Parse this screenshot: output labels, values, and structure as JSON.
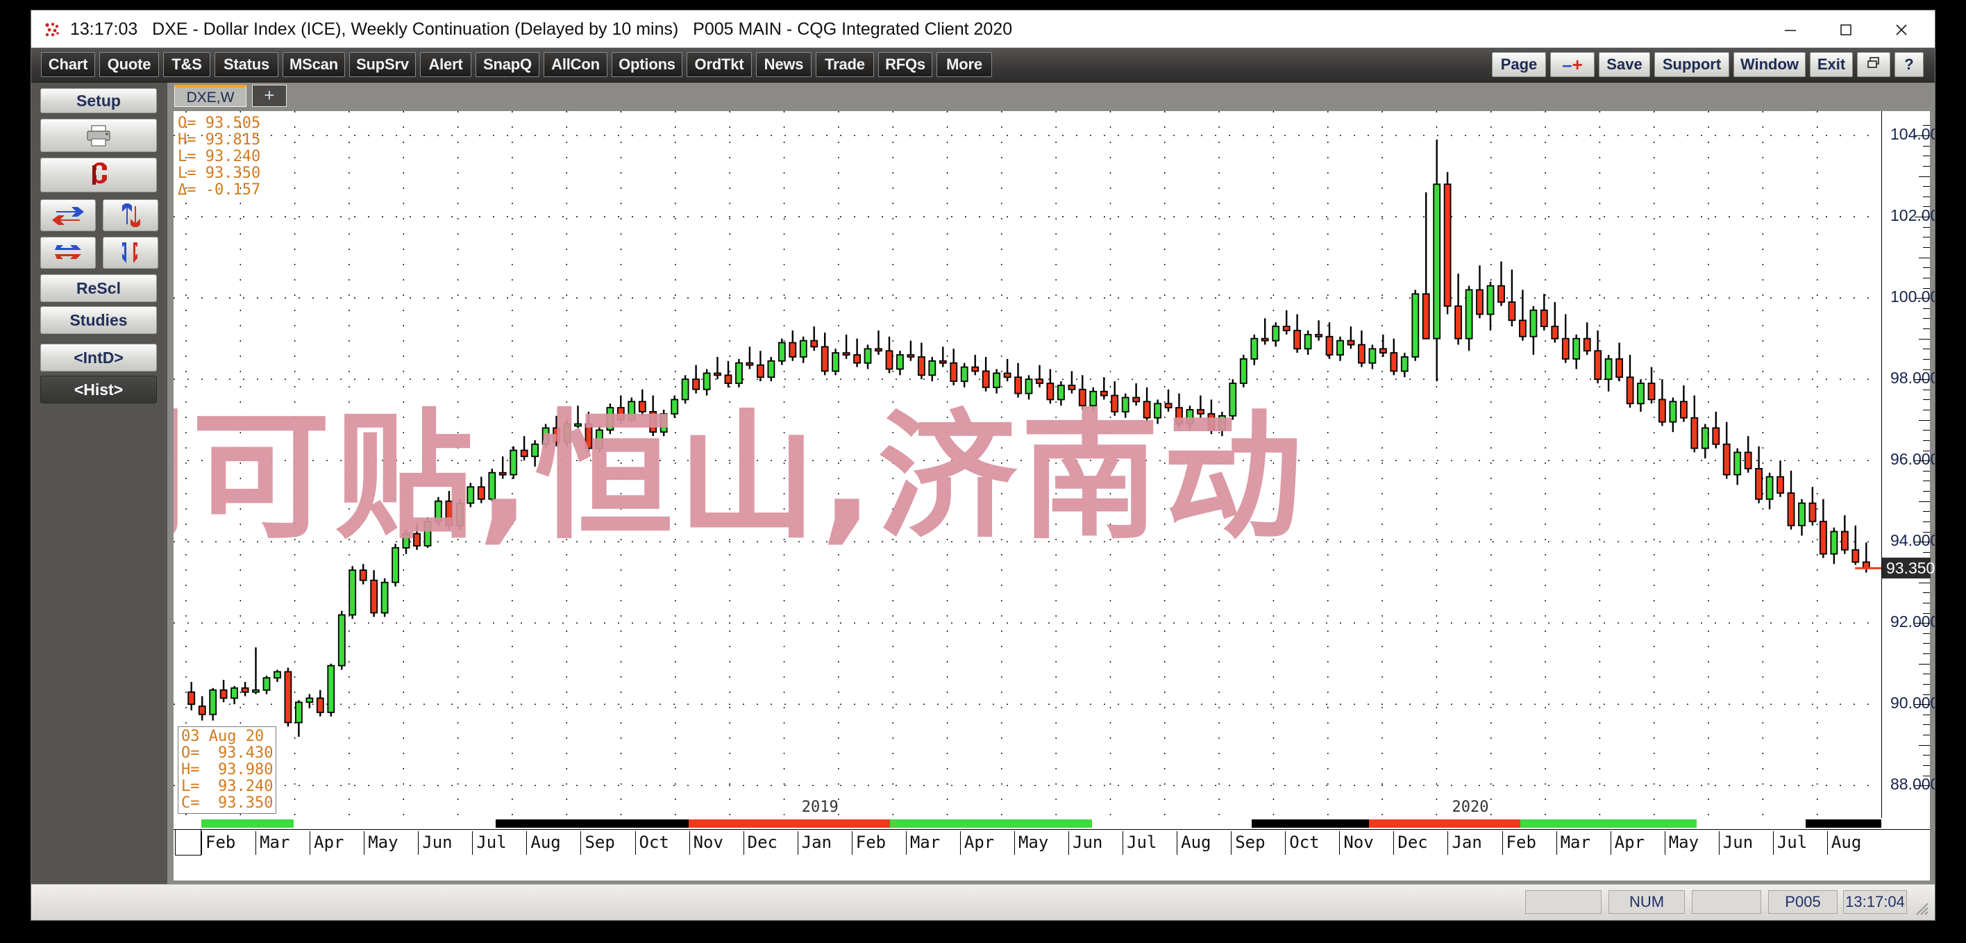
{
  "window": {
    "time": "13:17:03",
    "title": "DXE - Dollar Index (ICE), Weekly Continuation (Delayed by 10 mins)   P005 MAIN - CQG Integrated Client 2020",
    "minimize_label": "–",
    "maximize_label": "□",
    "close_label": "✕"
  },
  "toolbar": {
    "left_buttons": [
      {
        "label": "Chart",
        "w": 78
      },
      {
        "label": "Quote",
        "w": 86
      },
      {
        "label": "T&S",
        "w": 68
      },
      {
        "label": "Status",
        "w": 92
      },
      {
        "label": "MScan",
        "w": 90
      },
      {
        "label": "SupSrv",
        "w": 96
      },
      {
        "label": "Alert",
        "w": 74
      },
      {
        "label": "SnapQ",
        "w": 92
      },
      {
        "label": "AllCon",
        "w": 92
      },
      {
        "label": "Options",
        "w": 102
      },
      {
        "label": "OrdTkt",
        "w": 94
      },
      {
        "label": "News",
        "w": 80
      },
      {
        "label": "Trade",
        "w": 84
      },
      {
        "label": "RFQs",
        "w": 78
      },
      {
        "label": "More",
        "w": 80
      }
    ],
    "right_buttons": [
      {
        "label": "Page",
        "w": 78,
        "name": "page-button"
      },
      {
        "label": "-+",
        "w": 64,
        "name": "minus-plus-button"
      },
      {
        "label": "Save",
        "w": 74,
        "name": "save-button"
      },
      {
        "label": "Support",
        "w": 108,
        "name": "support-button"
      },
      {
        "label": "Window",
        "w": 104,
        "name": "window-button"
      },
      {
        "label": "Exit",
        "w": 62,
        "name": "exit-button"
      },
      {
        "label": "",
        "w": 48,
        "name": "restore-window-icon"
      },
      {
        "label": "?",
        "w": 42,
        "name": "help-button"
      }
    ]
  },
  "sidebar": {
    "items": [
      {
        "label": "Setup",
        "name": "setup-button"
      },
      {
        "label": "",
        "name": "print-icon-button"
      },
      {
        "label": "",
        "name": "magnet-icon-button"
      },
      {
        "label": "",
        "name": "swap-horizontal-icon-button"
      },
      {
        "label": "",
        "name": "swap-vertical-icon-button"
      },
      {
        "label": "",
        "name": "align-horizontal-icon-button"
      },
      {
        "label": "",
        "name": "align-vertical-icon-button"
      },
      {
        "label": "ReScl",
        "name": "rescale-button"
      },
      {
        "label": "Studies",
        "name": "studies-button"
      },
      {
        "label": "<IntD>",
        "name": "intraday-button"
      },
      {
        "label": "<Hist>",
        "name": "historical-button"
      }
    ]
  },
  "tabs": {
    "active": "DXE,W",
    "add": "+"
  },
  "readout_top": {
    "open_label": "O=",
    "open": "93.505",
    "high_label": "H=",
    "high": "93.815",
    "low_label": "L=",
    "low": "93.240",
    "last_label": "L=",
    "last": "93.350",
    "delta_label": "Δ=",
    "delta": "-0.157"
  },
  "readout_bottom": {
    "date": "03 Aug 20",
    "open_label": "O=",
    "open": "93.430",
    "high_label": "H=",
    "high": "93.980",
    "low_label": "L=",
    "low": "93.240",
    "close_label": "C=",
    "close": "93.350"
  },
  "watermark": {
    "text": "创可贴,恒山,济南动"
  },
  "statusbar": {
    "num": "NUM",
    "page": "P005",
    "time": "13:17:04"
  },
  "colors": {
    "up": "#3cdc3c",
    "down": "#ee3a1c",
    "wick": "#000000",
    "cursor_badge_bg": "#2b2b2b",
    "watermark": "#d8929e",
    "accent_tab": "#f7a520"
  },
  "chart_data": {
    "type": "candlestick",
    "title": "DXE - Dollar Index (ICE), Weekly Continuation",
    "xlabel": "",
    "ylabel": "",
    "ylim": [
      87.2,
      104.6
    ],
    "y_ticks": [
      104.0,
      102.0,
      100.0,
      98.0,
      96.0,
      94.0,
      92.0,
      90.0,
      88.0
    ],
    "cursor_price": "93.350",
    "grid": "dotted",
    "x_tick_labels": [
      "Feb",
      "Mar",
      "Apr",
      "May",
      "Jun",
      "Jul",
      "Aug",
      "Sep",
      "Oct",
      "Nov",
      "Dec",
      "Jan",
      "Feb",
      "Mar",
      "Apr",
      "May",
      "Jun",
      "Jul",
      "Aug",
      "Sep",
      "Oct",
      "Nov",
      "Dec",
      "Jan",
      "Feb",
      "Mar",
      "Apr",
      "May",
      "Jun",
      "Jul",
      "Aug"
    ],
    "year_labels": [
      {
        "text": "2019",
        "at_index": 11
      },
      {
        "text": "2020",
        "at_index": 23
      }
    ],
    "year_bar_segments": [
      {
        "start": 0.0,
        "end": 0.055,
        "color": "#3cdc3c"
      },
      {
        "start": 0.055,
        "end": 0.175,
        "color": "#ffffff"
      },
      {
        "start": 0.175,
        "end": 0.29,
        "color": "#000000"
      },
      {
        "start": 0.29,
        "end": 0.41,
        "color": "#ee3a1c"
      },
      {
        "start": 0.41,
        "end": 0.53,
        "color": "#3cdc3c"
      },
      {
        "start": 0.53,
        "end": 0.625,
        "color": "#ffffff"
      },
      {
        "start": 0.625,
        "end": 0.695,
        "color": "#000000"
      },
      {
        "start": 0.695,
        "end": 0.785,
        "color": "#ee3a1c"
      },
      {
        "start": 0.785,
        "end": 0.89,
        "color": "#3cdc3c"
      },
      {
        "start": 0.89,
        "end": 0.955,
        "color": "#ffffff"
      },
      {
        "start": 0.955,
        "end": 1.0,
        "color": "#000000"
      }
    ],
    "ohlc": [
      [
        90.3,
        90.55,
        89.85,
        90.0
      ],
      [
        89.95,
        90.2,
        89.6,
        89.75
      ],
      [
        89.75,
        90.4,
        89.6,
        90.35
      ],
      [
        90.35,
        90.6,
        90.05,
        90.15
      ],
      [
        90.15,
        90.45,
        90.0,
        90.4
      ],
      [
        90.4,
        90.55,
        90.2,
        90.3
      ],
      [
        90.3,
        91.4,
        90.25,
        90.35
      ],
      [
        90.35,
        90.7,
        90.25,
        90.65
      ],
      [
        90.65,
        90.85,
        90.55,
        90.8
      ],
      [
        90.8,
        90.9,
        89.45,
        89.55
      ],
      [
        89.55,
        90.1,
        89.2,
        90.05
      ],
      [
        90.05,
        90.25,
        89.9,
        90.15
      ],
      [
        90.15,
        90.35,
        89.7,
        89.8
      ],
      [
        89.8,
        91.0,
        89.7,
        90.95
      ],
      [
        90.95,
        92.3,
        90.85,
        92.2
      ],
      [
        92.2,
        93.4,
        92.1,
        93.3
      ],
      [
        93.3,
        93.45,
        92.95,
        93.05
      ],
      [
        93.05,
        93.3,
        92.15,
        92.25
      ],
      [
        92.25,
        93.1,
        92.15,
        93.0
      ],
      [
        93.0,
        93.95,
        92.9,
        93.85
      ],
      [
        93.85,
        94.3,
        93.7,
        94.2
      ],
      [
        94.2,
        94.45,
        93.8,
        93.9
      ],
      [
        93.9,
        94.6,
        93.85,
        94.5
      ],
      [
        94.5,
        95.1,
        94.4,
        95.0
      ],
      [
        95.0,
        95.25,
        94.3,
        94.4
      ],
      [
        94.4,
        95.05,
        94.3,
        94.95
      ],
      [
        94.95,
        95.45,
        94.85,
        95.35
      ],
      [
        95.35,
        95.6,
        94.95,
        95.05
      ],
      [
        95.05,
        95.8,
        95.0,
        95.7
      ],
      [
        95.7,
        96.1,
        95.55,
        95.65
      ],
      [
        95.65,
        96.35,
        95.55,
        96.25
      ],
      [
        96.25,
        96.6,
        96.0,
        96.1
      ],
      [
        96.1,
        96.5,
        95.85,
        96.4
      ],
      [
        96.4,
        96.9,
        96.3,
        96.8
      ],
      [
        96.8,
        97.1,
        96.35,
        96.45
      ],
      [
        96.45,
        97.0,
        96.35,
        96.9
      ],
      [
        96.9,
        97.35,
        96.8,
        96.9
      ],
      [
        96.9,
        97.2,
        96.2,
        96.3
      ],
      [
        96.3,
        96.85,
        96.2,
        96.75
      ],
      [
        96.75,
        97.4,
        96.65,
        97.3
      ],
      [
        97.3,
        97.6,
        96.9,
        97.0
      ],
      [
        97.0,
        97.55,
        96.95,
        97.45
      ],
      [
        97.45,
        97.75,
        97.1,
        97.2
      ],
      [
        97.2,
        97.6,
        96.6,
        96.7
      ],
      [
        96.7,
        97.25,
        96.6,
        97.15
      ],
      [
        97.15,
        97.6,
        97.05,
        97.5
      ],
      [
        97.5,
        98.1,
        97.4,
        98.0
      ],
      [
        98.0,
        98.35,
        97.65,
        97.75
      ],
      [
        97.75,
        98.25,
        97.6,
        98.15
      ],
      [
        98.15,
        98.55,
        98.0,
        98.1
      ],
      [
        98.1,
        98.45,
        97.8,
        97.9
      ],
      [
        97.9,
        98.5,
        97.8,
        98.4
      ],
      [
        98.4,
        98.8,
        98.25,
        98.35
      ],
      [
        98.35,
        98.7,
        97.95,
        98.05
      ],
      [
        98.05,
        98.55,
        97.95,
        98.45
      ],
      [
        98.45,
        99.0,
        98.35,
        98.9
      ],
      [
        98.9,
        99.2,
        98.45,
        98.55
      ],
      [
        98.55,
        99.05,
        98.4,
        98.95
      ],
      [
        98.95,
        99.3,
        98.7,
        98.8
      ],
      [
        98.8,
        99.15,
        98.1,
        98.2
      ],
      [
        98.2,
        98.75,
        98.1,
        98.65
      ],
      [
        98.65,
        99.1,
        98.5,
        98.6
      ],
      [
        98.6,
        99.0,
        98.3,
        98.4
      ],
      [
        98.4,
        98.85,
        98.25,
        98.75
      ],
      [
        98.75,
        99.2,
        98.6,
        98.7
      ],
      [
        98.7,
        99.05,
        98.15,
        98.25
      ],
      [
        98.25,
        98.7,
        98.1,
        98.6
      ],
      [
        98.6,
        98.95,
        98.45,
        98.55
      ],
      [
        98.55,
        98.9,
        98.0,
        98.1
      ],
      [
        98.1,
        98.55,
        97.95,
        98.45
      ],
      [
        98.45,
        98.8,
        98.3,
        98.4
      ],
      [
        98.4,
        98.75,
        97.85,
        97.95
      ],
      [
        97.95,
        98.4,
        97.8,
        98.3
      ],
      [
        98.3,
        98.6,
        98.1,
        98.2
      ],
      [
        98.2,
        98.55,
        97.7,
        97.8
      ],
      [
        97.8,
        98.25,
        97.65,
        98.15
      ],
      [
        98.15,
        98.5,
        97.95,
        98.05
      ],
      [
        98.05,
        98.4,
        97.55,
        97.65
      ],
      [
        97.65,
        98.1,
        97.5,
        98.0
      ],
      [
        98.0,
        98.35,
        97.8,
        97.9
      ],
      [
        97.9,
        98.25,
        97.4,
        97.5
      ],
      [
        97.5,
        97.95,
        97.35,
        97.85
      ],
      [
        97.85,
        98.2,
        97.65,
        97.75
      ],
      [
        97.75,
        98.1,
        97.25,
        97.35
      ],
      [
        97.35,
        97.8,
        97.2,
        97.7
      ],
      [
        97.7,
        98.05,
        97.5,
        97.6
      ],
      [
        97.6,
        97.95,
        97.1,
        97.2
      ],
      [
        97.2,
        97.65,
        97.05,
        97.55
      ],
      [
        97.55,
        97.9,
        97.35,
        97.45
      ],
      [
        97.45,
        97.8,
        96.95,
        97.05
      ],
      [
        97.05,
        97.5,
        96.9,
        97.4
      ],
      [
        97.4,
        97.75,
        97.2,
        97.3
      ],
      [
        97.3,
        97.65,
        96.8,
        96.9
      ],
      [
        96.9,
        97.35,
        96.75,
        97.25
      ],
      [
        97.25,
        97.6,
        97.05,
        97.15
      ],
      [
        97.15,
        97.5,
        96.65,
        96.75
      ],
      [
        96.75,
        97.2,
        96.6,
        97.1
      ],
      [
        97.1,
        98.0,
        97.0,
        97.9
      ],
      [
        97.9,
        98.6,
        97.8,
        98.5
      ],
      [
        98.5,
        99.1,
        98.35,
        99.0
      ],
      [
        99.0,
        99.5,
        98.85,
        98.95
      ],
      [
        98.95,
        99.4,
        98.8,
        99.3
      ],
      [
        99.3,
        99.7,
        99.1,
        99.2
      ],
      [
        99.2,
        99.6,
        98.65,
        98.75
      ],
      [
        98.75,
        99.2,
        98.6,
        99.1
      ],
      [
        99.1,
        99.45,
        98.95,
        99.05
      ],
      [
        99.05,
        99.4,
        98.5,
        98.6
      ],
      [
        98.6,
        99.05,
        98.45,
        98.95
      ],
      [
        98.95,
        99.3,
        98.75,
        98.85
      ],
      [
        98.85,
        99.2,
        98.3,
        98.4
      ],
      [
        98.4,
        98.85,
        98.25,
        98.75
      ],
      [
        98.75,
        99.1,
        98.55,
        98.65
      ],
      [
        98.65,
        99.0,
        98.1,
        98.2
      ],
      [
        98.2,
        98.65,
        98.05,
        98.55
      ],
      [
        98.55,
        100.2,
        98.45,
        100.1
      ],
      [
        100.1,
        102.6,
        99.95,
        99.0
      ],
      [
        99.0,
        103.9,
        97.95,
        102.8
      ],
      [
        102.8,
        103.1,
        99.6,
        99.8
      ],
      [
        99.8,
        100.6,
        98.85,
        99.0
      ],
      [
        99.0,
        100.3,
        98.7,
        100.2
      ],
      [
        100.2,
        100.8,
        99.5,
        99.6
      ],
      [
        99.6,
        100.4,
        99.2,
        100.3
      ],
      [
        100.3,
        100.9,
        99.8,
        99.9
      ],
      [
        99.9,
        100.7,
        99.3,
        99.45
      ],
      [
        99.45,
        100.2,
        98.95,
        99.05
      ],
      [
        99.05,
        99.8,
        98.6,
        99.7
      ],
      [
        99.7,
        100.1,
        99.2,
        99.3
      ],
      [
        99.3,
        99.9,
        98.9,
        99.0
      ],
      [
        99.0,
        99.6,
        98.4,
        98.5
      ],
      [
        98.5,
        99.1,
        98.25,
        99.0
      ],
      [
        99.0,
        99.4,
        98.6,
        98.7
      ],
      [
        98.7,
        99.2,
        97.9,
        98.0
      ],
      [
        98.0,
        98.6,
        97.7,
        98.5
      ],
      [
        98.5,
        98.9,
        97.95,
        98.05
      ],
      [
        98.05,
        98.6,
        97.3,
        97.4
      ],
      [
        97.4,
        98.0,
        97.2,
        97.9
      ],
      [
        97.9,
        98.3,
        97.4,
        97.5
      ],
      [
        97.5,
        98.0,
        96.85,
        96.95
      ],
      [
        96.95,
        97.55,
        96.7,
        97.45
      ],
      [
        97.45,
        97.85,
        96.95,
        97.05
      ],
      [
        97.05,
        97.6,
        96.2,
        96.3
      ],
      [
        96.3,
        96.9,
        96.05,
        96.8
      ],
      [
        96.8,
        97.2,
        96.3,
        96.4
      ],
      [
        96.4,
        96.95,
        95.55,
        95.65
      ],
      [
        95.65,
        96.3,
        95.4,
        96.2
      ],
      [
        96.2,
        96.6,
        95.7,
        95.8
      ],
      [
        95.8,
        96.35,
        94.95,
        95.05
      ],
      [
        95.05,
        95.7,
        94.8,
        95.6
      ],
      [
        95.6,
        96.0,
        95.1,
        95.2
      ],
      [
        95.2,
        95.75,
        94.3,
        94.4
      ],
      [
        94.4,
        95.05,
        94.15,
        94.95
      ],
      [
        94.95,
        95.35,
        94.4,
        94.5
      ],
      [
        94.5,
        95.05,
        93.6,
        93.7
      ],
      [
        93.7,
        94.35,
        93.45,
        94.25
      ],
      [
        94.25,
        94.65,
        93.7,
        93.8
      ],
      [
        93.8,
        94.4,
        93.43,
        93.5
      ],
      [
        93.5,
        93.98,
        93.24,
        93.35
      ]
    ]
  }
}
